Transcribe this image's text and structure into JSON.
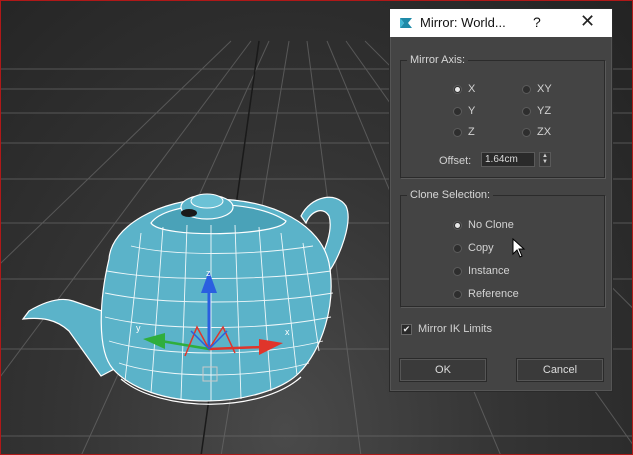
{
  "dialog": {
    "title": "Mirror: World...",
    "help_label": "?",
    "close_label": "✕",
    "mirror_axis": {
      "label": "Mirror Axis:",
      "options": [
        {
          "label": "X",
          "checked": true
        },
        {
          "label": "Y",
          "checked": false
        },
        {
          "label": "Z",
          "checked": false
        },
        {
          "label": "XY",
          "checked": false
        },
        {
          "label": "YZ",
          "checked": false
        },
        {
          "label": "ZX",
          "checked": false
        }
      ],
      "offset_label": "Offset:",
      "offset_value": "1.64cm"
    },
    "clone_selection": {
      "label": "Clone Selection:",
      "options": [
        {
          "label": "No Clone",
          "checked": true
        },
        {
          "label": "Copy",
          "checked": false
        },
        {
          "label": "Instance",
          "checked": false
        },
        {
          "label": "Reference",
          "checked": false
        }
      ]
    },
    "mirror_ik": {
      "label": "Mirror IK Limits",
      "checked": true
    },
    "ok_label": "OK",
    "cancel_label": "Cancel"
  },
  "gizmo": {
    "x_label": "x",
    "y_label": "y",
    "z_label": "z"
  },
  "colors": {
    "teapot": "#5bb3c9",
    "x_axis": "#e0352b",
    "y_axis": "#2fae3c",
    "z_axis": "#2a5fe0"
  }
}
